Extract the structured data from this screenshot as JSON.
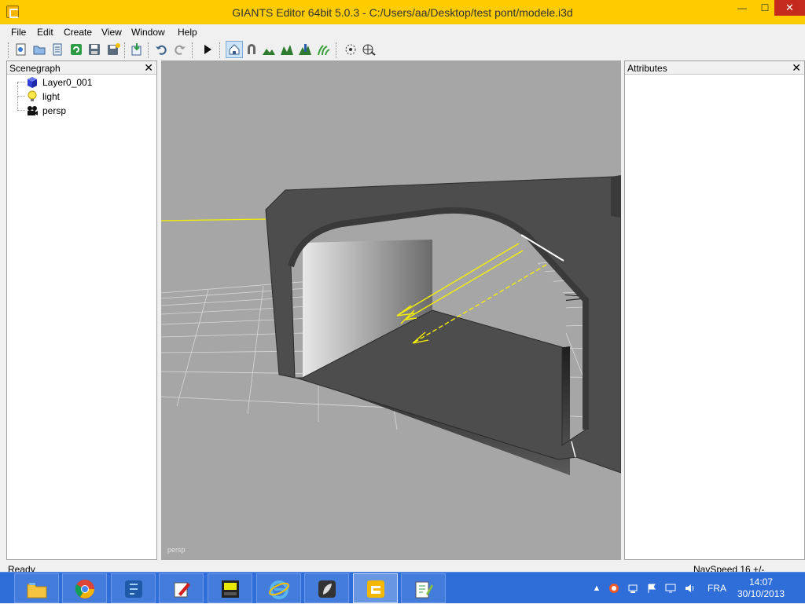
{
  "window": {
    "title": "GIANTS Editor 64bit 5.0.3 - C:/Users/aa/Desktop/test pont/modele.i3d",
    "minimize": "—",
    "maximize": "☐",
    "close": "✕"
  },
  "menu": {
    "file": "File",
    "edit": "Edit",
    "create": "Create",
    "view": "View",
    "window": "Window",
    "help": "Help"
  },
  "toolbar": {
    "icons": [
      "new-file-icon",
      "open-icon",
      "list-icon",
      "refresh-icon",
      "save-icon",
      "save-as-icon",
      "import-icon",
      "undo-icon",
      "redo-icon",
      "play-icon",
      "home-icon",
      "magnet-icon",
      "terrain-paint-icon",
      "terrain-sculpt-icon",
      "foliage-icon",
      "grass-icon",
      "particle-icon",
      "mesh-icon"
    ]
  },
  "scenegraph": {
    "title": "Scenegraph",
    "close": "✕",
    "items": [
      {
        "label": "Layer0_001",
        "icon": "cube-icon"
      },
      {
        "label": "light",
        "icon": "lightbulb-icon"
      },
      {
        "label": "persp",
        "icon": "camera-icon"
      }
    ]
  },
  "attributes": {
    "title": "Attributes",
    "close": "✕"
  },
  "viewport": {
    "camera_label": "persp",
    "background": "#a6a6a6"
  },
  "status": {
    "ready": "Ready",
    "navspeed": "NavSpeed 16 +/-"
  },
  "taskbar": {
    "apps": [
      "file-explorer-icon",
      "chrome-icon",
      "launcher-icon",
      "paint-icon",
      "game-icon",
      "internet-explorer-icon",
      "leaf-app-icon",
      "giants-editor-icon",
      "notepad-plus-icon"
    ],
    "language": "FRA",
    "time": "14:07",
    "date": "30/10/2013"
  },
  "colors": {
    "titlebar": "#ffcc00",
    "taskbar": "#2f6ed8",
    "light_gizmo": "#f5f000"
  }
}
